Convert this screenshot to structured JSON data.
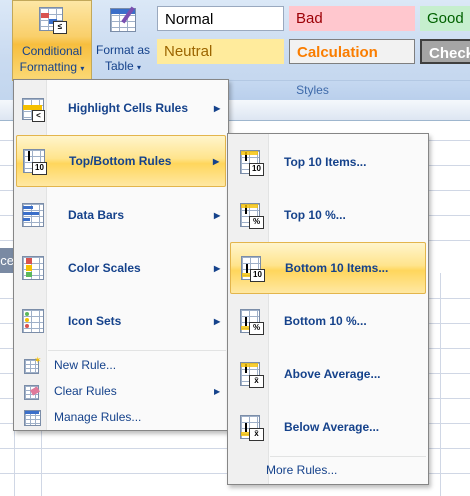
{
  "ribbon": {
    "conditional_formatting": {
      "line1": "Conditional",
      "line2": "Formatting",
      "icon": "conditional-formatting-icon"
    },
    "format_as_table": {
      "line1": "Format as",
      "line2": "Table",
      "icon": "format-as-table-icon"
    },
    "styles": {
      "normal": "Normal",
      "bad": "Bad",
      "good": "Good",
      "neutral": "Neutral",
      "calculation": "Calculation",
      "check": "Check Cell"
    },
    "styles_group_label": "Styles"
  },
  "sheet": {
    "row_header_fragment": "ce"
  },
  "menu": {
    "items": [
      {
        "label": "Highlight Cells Rules",
        "icon": "highlight-cells-rules-icon",
        "submenu": true
      },
      {
        "label": "Top/Bottom Rules",
        "icon": "top-bottom-rules-icon",
        "submenu": true,
        "highlighted": true
      },
      {
        "label": "Data Bars",
        "icon": "data-bars-icon",
        "submenu": true
      },
      {
        "label": "Color Scales",
        "icon": "color-scales-icon",
        "submenu": true
      },
      {
        "label": "Icon Sets",
        "icon": "icon-sets-icon",
        "submenu": true
      }
    ],
    "small_items": [
      {
        "label": "New Rule...",
        "icon": "new-rule-icon"
      },
      {
        "label": "Clear Rules",
        "icon": "clear-rules-icon",
        "submenu": true
      },
      {
        "label": "Manage Rules...",
        "icon": "manage-rules-icon"
      }
    ]
  },
  "submenu": {
    "items": [
      {
        "label": "Top 10 Items...",
        "icon": "top-10-items-icon",
        "tag": "10"
      },
      {
        "label": "Top 10 %...",
        "icon": "top-10-percent-icon",
        "tag": "%"
      },
      {
        "label": "Bottom 10 Items...",
        "icon": "bottom-10-items-icon",
        "tag": "10",
        "highlighted": true
      },
      {
        "label": "Bottom 10 %...",
        "icon": "bottom-10-percent-icon",
        "tag": "%"
      },
      {
        "label": "Above Average...",
        "icon": "above-average-icon",
        "tag": "x̄"
      },
      {
        "label": "Below Average...",
        "icon": "below-average-icon",
        "tag": "x̄"
      }
    ],
    "more_rules": "More Rules..."
  },
  "colors": {
    "highlight": "#ffd65c",
    "menu_text": "#15428b",
    "ribbon": "#c9daf0"
  }
}
